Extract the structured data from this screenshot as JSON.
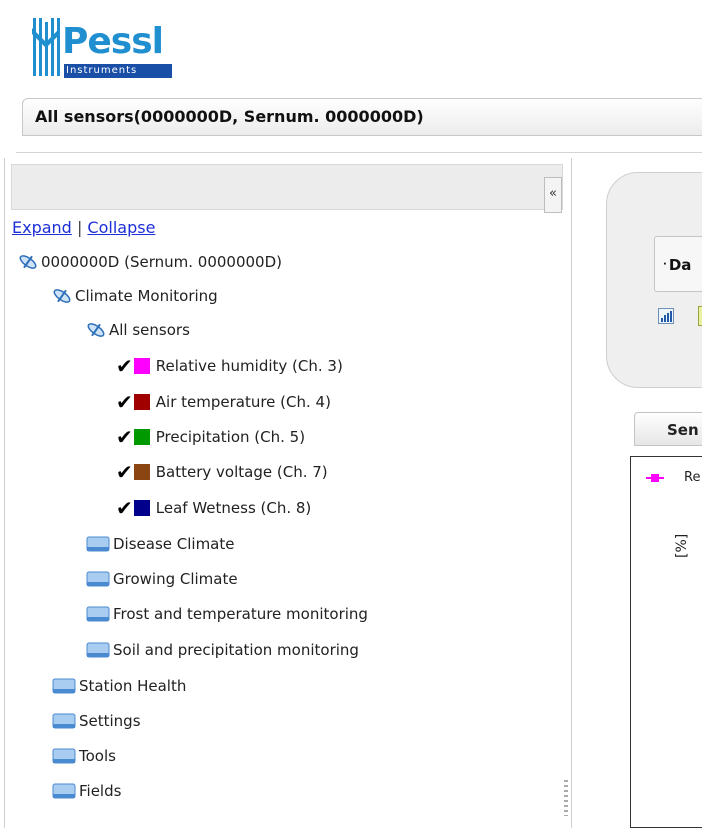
{
  "logo": {
    "word": "Pessl",
    "sub": "Instruments"
  },
  "header": {
    "title": "All sensors(0000000D, Sernum. 0000000D)"
  },
  "sidebar": {
    "collapse_label": "«",
    "expand_label": "Expand",
    "separator": "|",
    "collapse_link_label": "Collapse",
    "tree": {
      "station": "0000000D (Sernum. 0000000D)",
      "climate_monitoring": "Climate Monitoring",
      "all_sensors": "All sensors",
      "sensors": [
        {
          "label": "Relative humidity (Ch. 3)",
          "color": "#ff00ff",
          "checked": true
        },
        {
          "label": "Air temperature (Ch. 4)",
          "color": "#a00000",
          "checked": true
        },
        {
          "label": "Precipitation (Ch. 5)",
          "color": "#009a00",
          "checked": true
        },
        {
          "label": "Battery voltage (Ch. 7)",
          "color": "#8b4513",
          "checked": true
        },
        {
          "label": "Leaf Wetness (Ch. 8)",
          "color": "#00008b",
          "checked": true
        }
      ],
      "climate_children": [
        "Disease Climate",
        "Growing Climate",
        "Frost and temperature monitoring",
        "Soil and precipitation monitoring"
      ],
      "station_children": [
        "Station Health",
        "Settings",
        "Tools",
        "Fields"
      ]
    }
  },
  "main": {
    "date_button_label": "Da",
    "sensors_tab_label": "Sen",
    "legend_label": "Re",
    "y_unit": "[%]"
  }
}
